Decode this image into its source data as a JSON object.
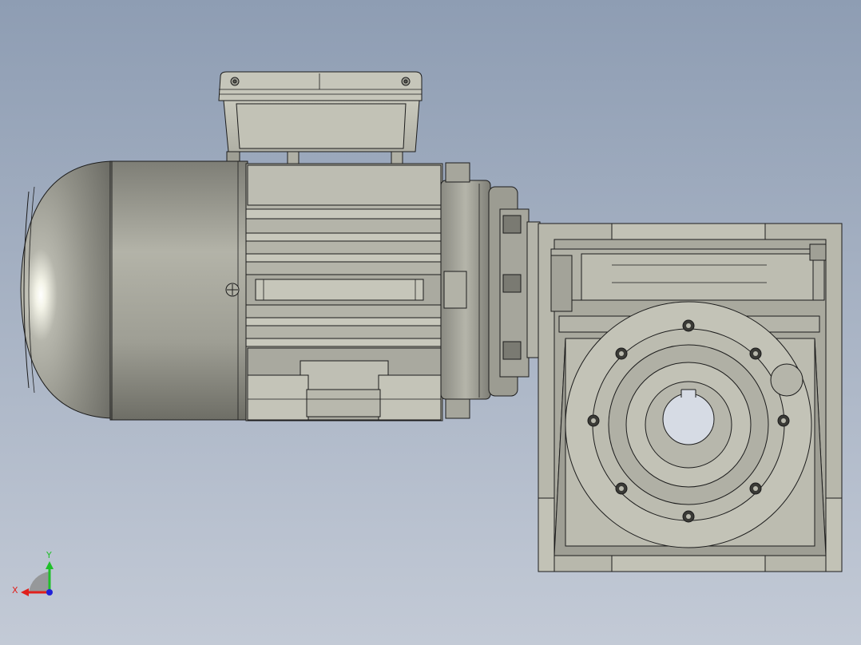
{
  "viewport": {
    "background_top": "#8e9db3",
    "background_bottom": "#c3cad6"
  },
  "model": {
    "body_color": "#b9b9ad",
    "shade_color": "#9a9a90",
    "dark_color": "#6e6e66",
    "edge_color": "#1c1c1c",
    "fan_cover_color": "#a8a8a0"
  },
  "triad": {
    "x_label": "X",
    "y_label": "Y",
    "x_color": "#e0201c",
    "y_color": "#1fbf2a",
    "z_color": "#2020d8"
  }
}
